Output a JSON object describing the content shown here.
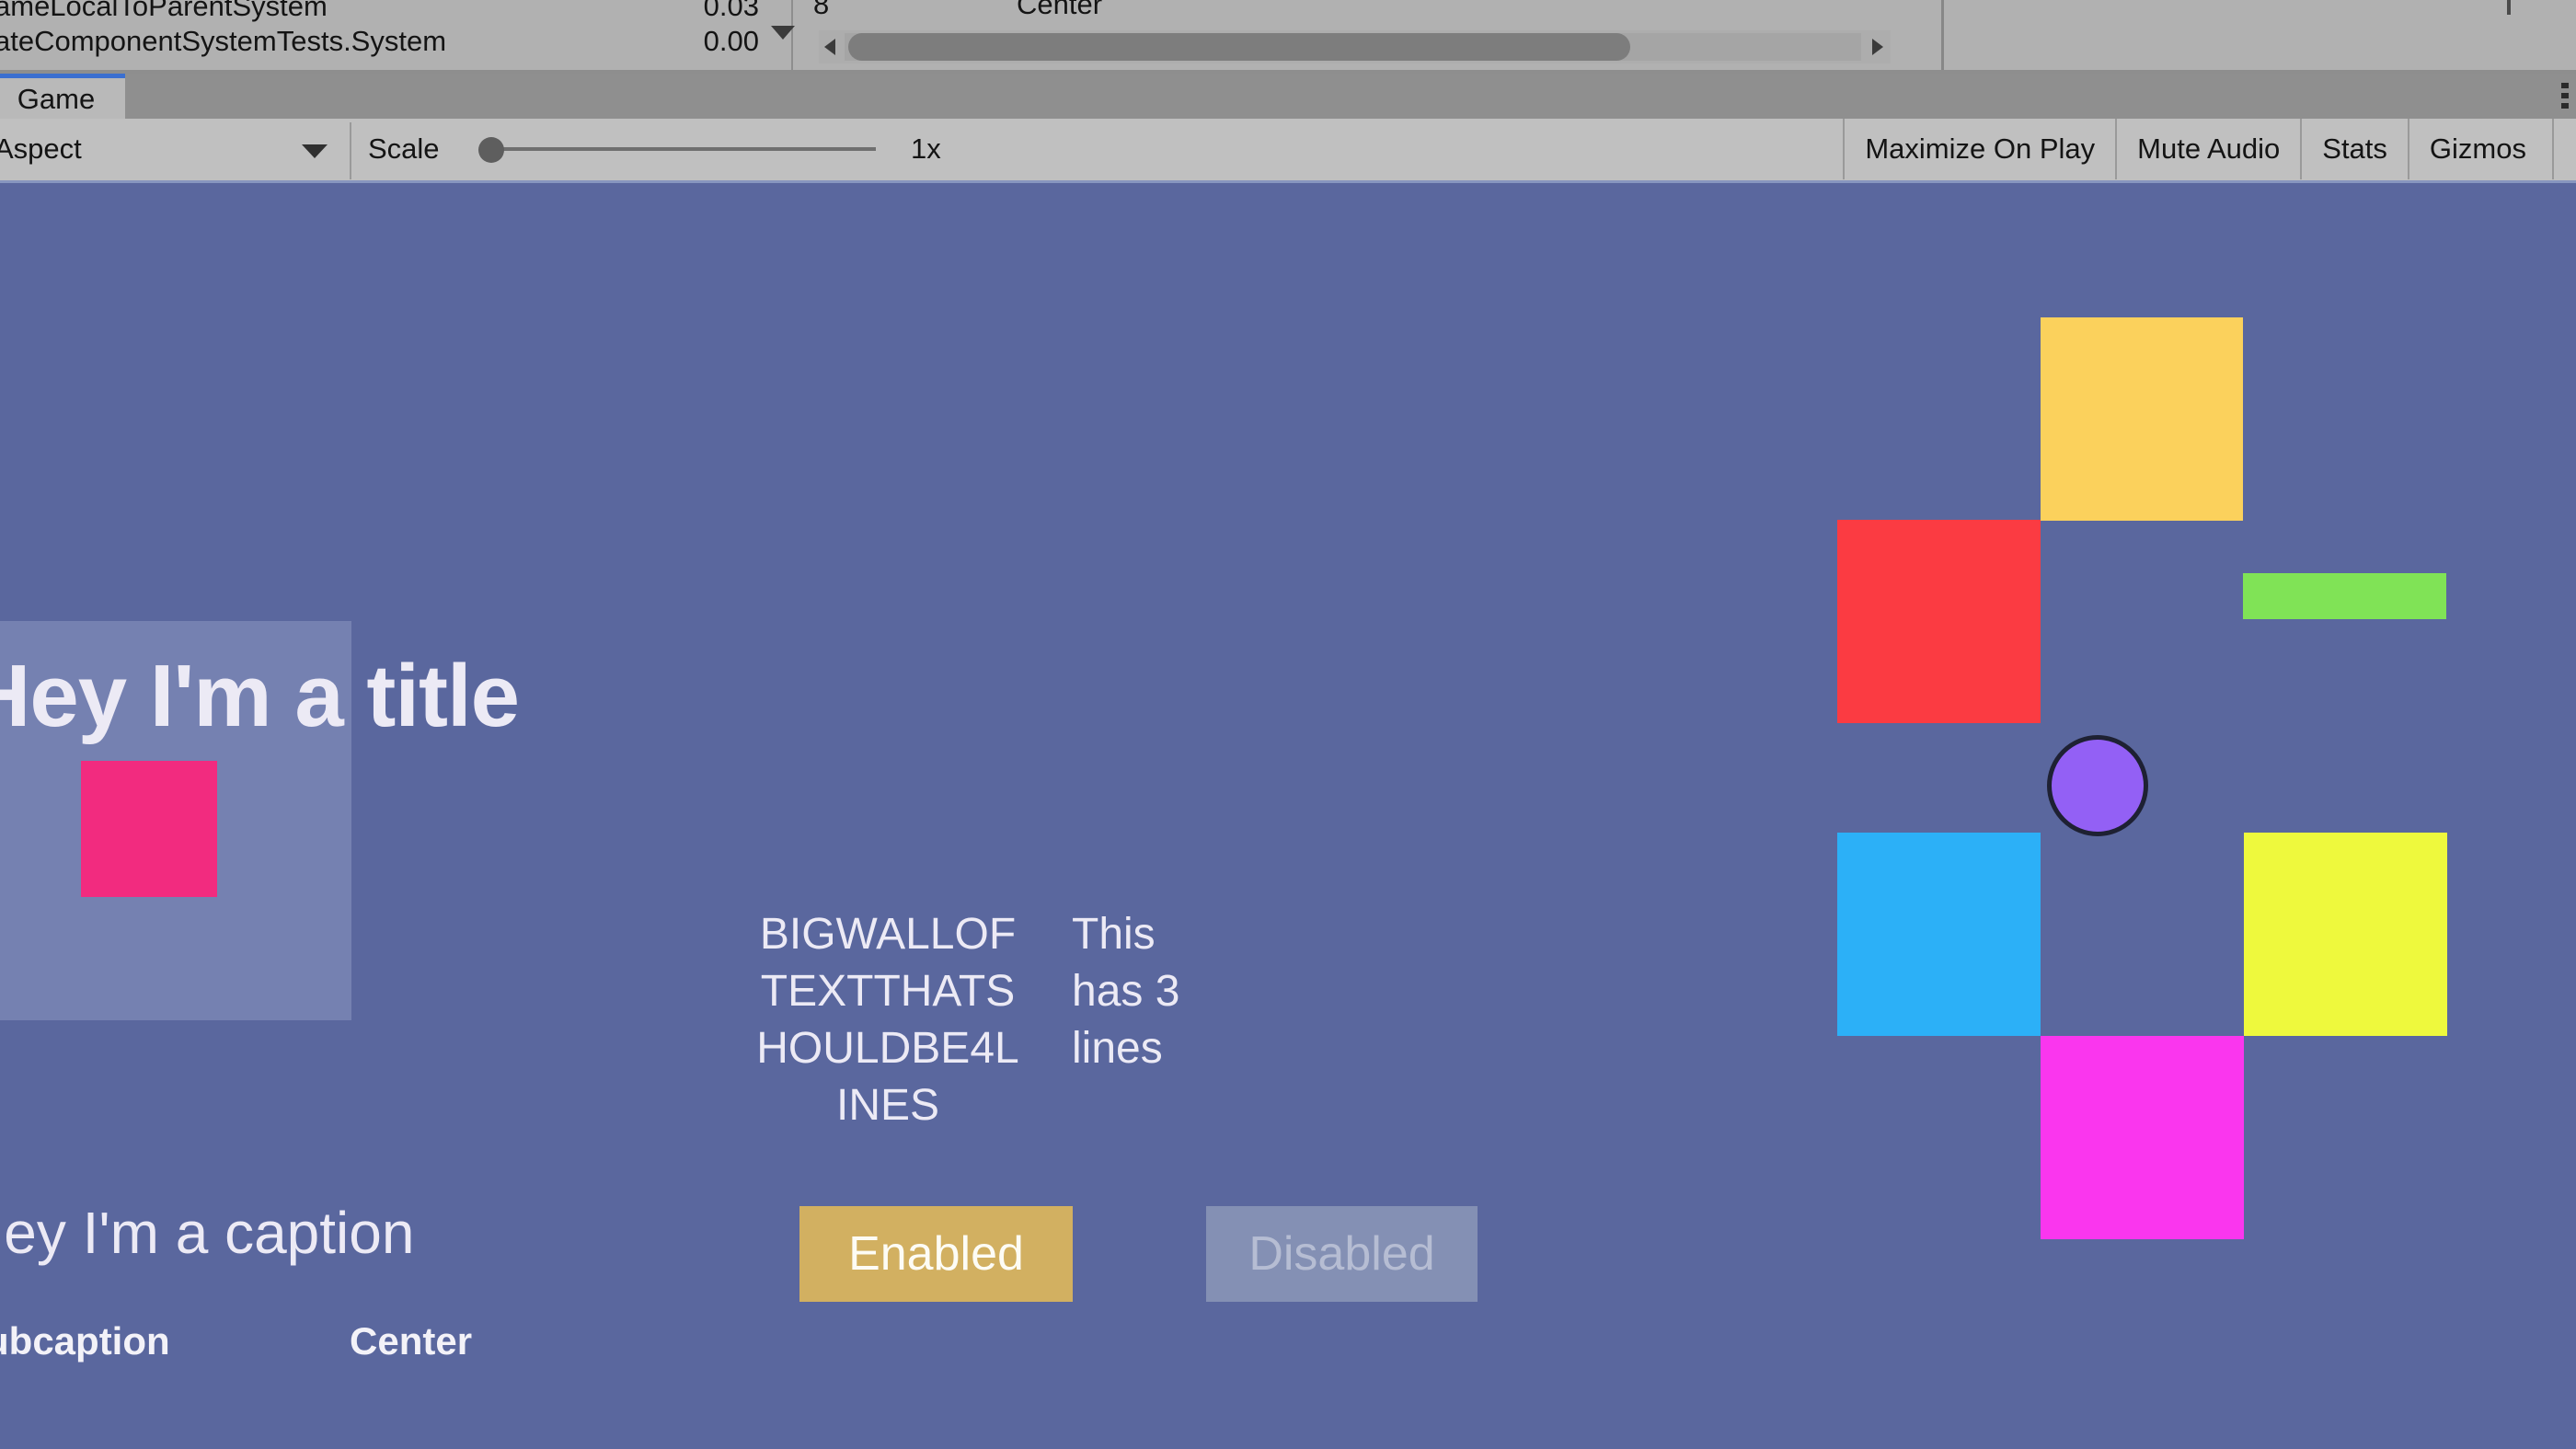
{
  "editor": {
    "profiler": {
      "rows": [
        {
          "name": "ameLocalToParentSystem",
          "value": "0.03"
        },
        {
          "name": "ateComponentSystemTests.System",
          "value": "0.00"
        }
      ],
      "right_column_number": "8",
      "right_column_label": "Center"
    },
    "tab": {
      "label": "Game"
    },
    "toolbar": {
      "aspect_label": "Aspect",
      "scale_label": "Scale",
      "scale_value": "1x",
      "maximize_on_play": "Maximize On Play",
      "mute_audio": "Mute Audio",
      "stats": "Stats",
      "gizmos": "Gizmos"
    }
  },
  "game": {
    "title": "Hey I'm a title",
    "caption": "Hey I'm a caption",
    "subcaption": "Subcaption",
    "center_label": "Center",
    "big_wall_text": "BIGWALLOFTEXTTHATSHOULDBE4LINES",
    "three_lines_text": "This has 3 lines",
    "button_enabled": "Enabled",
    "button_disabled": "Disabled",
    "colors": {
      "background": "#5a679e",
      "panel": "#7581b1",
      "pink_square": "#f22b7f",
      "yellow_square": "#fbd15c",
      "red_square": "#fb3b42",
      "green_rect": "#80e356",
      "purple_circle": "#9360f5",
      "cyan_square": "#2cb0f7",
      "yellow_square_2": "#eef93d",
      "magenta_square": "#fa36ee",
      "button_enabled_bg": "#d2b061",
      "button_disabled_bg": "#8490b4",
      "text": "#eceaf5"
    }
  }
}
